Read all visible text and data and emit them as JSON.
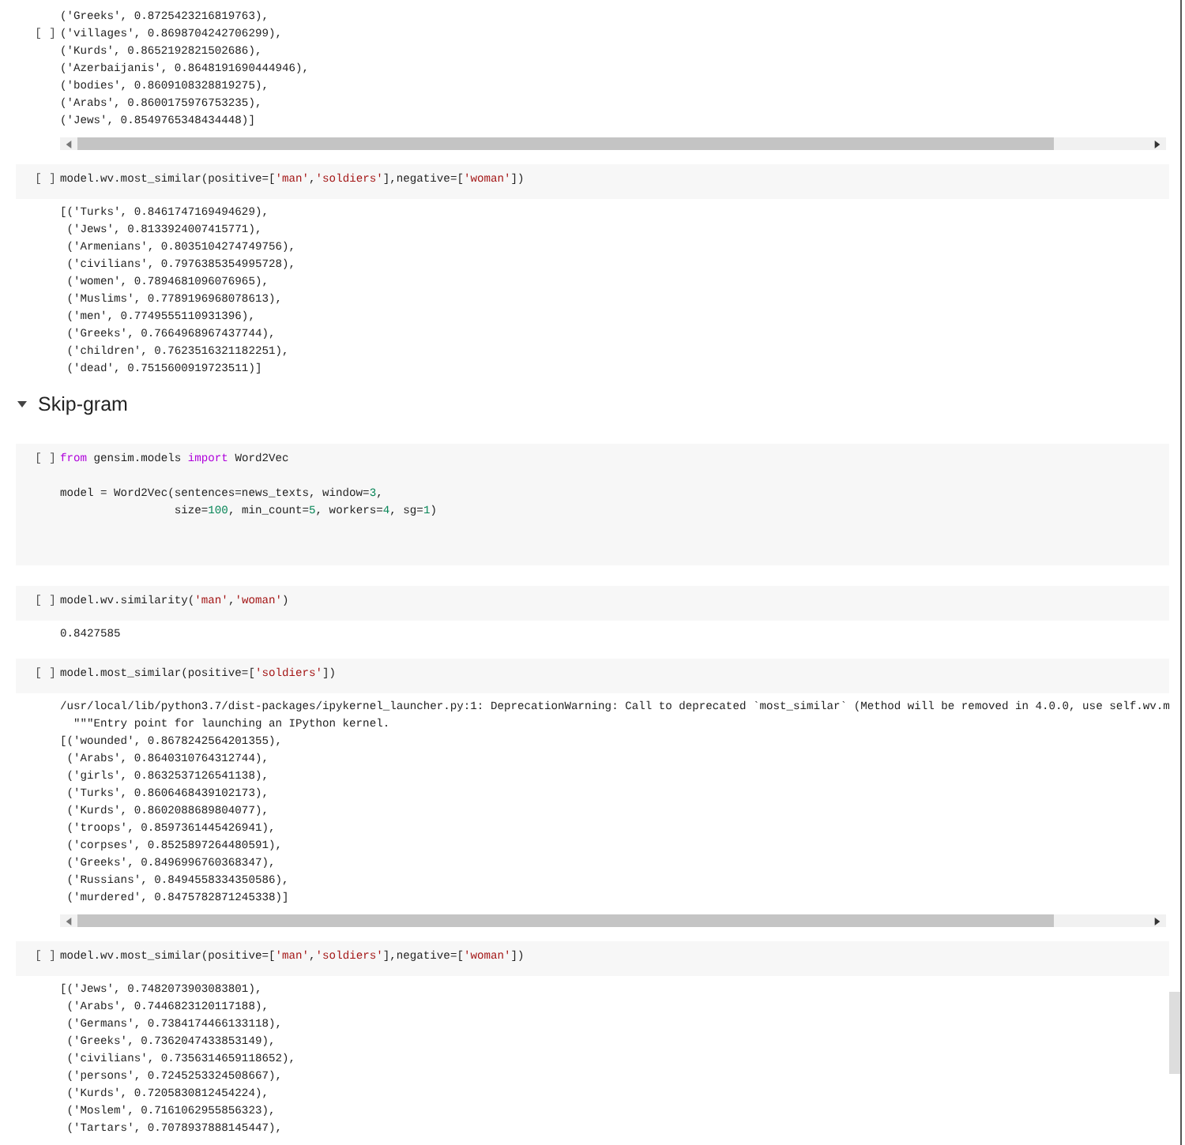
{
  "cells": [
    {
      "kind": "output",
      "run_label": "[ ]",
      "scrollable": true,
      "lines": [
        "('Greeks', 0.8725423216819763),",
        "('villages', 0.8698704242706299),",
        "('Kurds', 0.8652192821502686),",
        "('Azerbaijanis', 0.8648191690444946),",
        "('bodies', 0.8609108328819275),",
        "('Arabs', 0.8600175976753235),",
        "('Jews', 0.8549765348434448)]"
      ]
    },
    {
      "kind": "code",
      "run_label": "[ ]",
      "code": [
        [
          {
            "t": "model.wv.most_similar(positive=[",
            "kind": "plain"
          },
          {
            "t": "'man'",
            "kind": "string"
          },
          {
            "t": ",",
            "kind": "plain"
          },
          {
            "t": "'soldiers'",
            "kind": "string"
          },
          {
            "t": "],negative=[",
            "kind": "plain"
          },
          {
            "t": "'woman'",
            "kind": "string"
          },
          {
            "t": "])",
            "kind": "plain"
          }
        ]
      ],
      "lines": [
        "[('Turks', 0.8461747169494629),",
        " ('Jews', 0.8133924007415771),",
        " ('Armenians', 0.8035104274749756),",
        " ('civilians', 0.7976385354995728),",
        " ('women', 0.7894681096076965),",
        " ('Muslims', 0.7789196968078613),",
        " ('men', 0.7749555110931396),",
        " ('Greeks', 0.7664968967437744),",
        " ('children', 0.7623516321182251),",
        " ('dead', 0.7515600919723511)]"
      ]
    },
    {
      "kind": "heading",
      "text": "Skip-gram",
      "expanded": true
    },
    {
      "kind": "code",
      "run_label": "[ ]",
      "code": [
        [
          {
            "t": "from",
            "kind": "keyword"
          },
          {
            "t": " gensim.models ",
            "kind": "plain"
          },
          {
            "t": "import",
            "kind": "keyword"
          },
          {
            "t": " Word2Vec",
            "kind": "plain"
          }
        ],
        [
          {
            "kind": "blank"
          }
        ],
        [
          {
            "t": "model = Word2Vec(sentences=news_texts, window=",
            "kind": "plain"
          },
          {
            "t": "3",
            "kind": "number"
          },
          {
            "t": ",",
            "kind": "plain"
          }
        ],
        [
          {
            "t": "                 size=",
            "kind": "plain"
          },
          {
            "t": "100",
            "kind": "number"
          },
          {
            "t": ", min_count=",
            "kind": "plain"
          },
          {
            "t": "5",
            "kind": "number"
          },
          {
            "t": ", workers=",
            "kind": "plain"
          },
          {
            "t": "4",
            "kind": "number"
          },
          {
            "t": ", sg=",
            "kind": "plain"
          },
          {
            "t": "1",
            "kind": "number"
          },
          {
            "t": ")",
            "kind": "plain"
          }
        ],
        [
          {
            "kind": "blank"
          }
        ],
        [
          {
            "kind": "blank"
          }
        ]
      ]
    },
    {
      "kind": "code",
      "run_label": "[ ]",
      "code": [
        [
          {
            "t": "model.wv.similarity(",
            "kind": "plain"
          },
          {
            "t": "'man'",
            "kind": "string"
          },
          {
            "t": ",",
            "kind": "plain"
          },
          {
            "t": "'woman'",
            "kind": "string"
          },
          {
            "t": ")",
            "kind": "plain"
          }
        ]
      ],
      "lines": [
        "0.8427585"
      ]
    },
    {
      "kind": "code",
      "run_label": "[ ]",
      "code": [
        [
          {
            "t": "model.most_similar(positive=[",
            "kind": "plain"
          },
          {
            "t": "'soldiers'",
            "kind": "string"
          },
          {
            "t": "])",
            "kind": "plain"
          }
        ]
      ],
      "scrollable": true,
      "lines": [
        "/usr/local/lib/python3.7/dist-packages/ipykernel_launcher.py:1: DeprecationWarning: Call to deprecated `most_similar` (Method will be removed in 4.0.0, use self.wv.m",
        "  \"\"\"Entry point for launching an IPython kernel.",
        "[('wounded', 0.8678242564201355),",
        " ('Arabs', 0.8640310764312744),",
        " ('girls', 0.8632537126541138),",
        " ('Turks', 0.8606468439102173),",
        " ('Kurds', 0.8602088689804077),",
        " ('troops', 0.8597361445426941),",
        " ('corpses', 0.8525897264480591),",
        " ('Greeks', 0.8496996760368347),",
        " ('Russians', 0.8494558334350586),",
        " ('murdered', 0.8475782871245338)]"
      ]
    },
    {
      "kind": "code",
      "run_label": "[ ]",
      "code": [
        [
          {
            "t": "model.wv.most_similar(positive=[",
            "kind": "plain"
          },
          {
            "t": "'man'",
            "kind": "string"
          },
          {
            "t": ",",
            "kind": "plain"
          },
          {
            "t": "'soldiers'",
            "kind": "string"
          },
          {
            "t": "],negative=[",
            "kind": "plain"
          },
          {
            "t": "'woman'",
            "kind": "string"
          },
          {
            "t": "])",
            "kind": "plain"
          }
        ]
      ],
      "lines": [
        "[('Jews', 0.7482073903083801),",
        " ('Arabs', 0.7446823120117188),",
        " ('Germans', 0.7384174466133118),",
        " ('Greeks', 0.7362047433853149),",
        " ('civilians', 0.7356314659118652),",
        " ('persons', 0.7245253324508667),",
        " ('Kurds', 0.7205830812454224),",
        " ('Moslem', 0.7161062955856323),",
        " ('Tartars', 0.7078937888145447),"
      ]
    }
  ]
}
